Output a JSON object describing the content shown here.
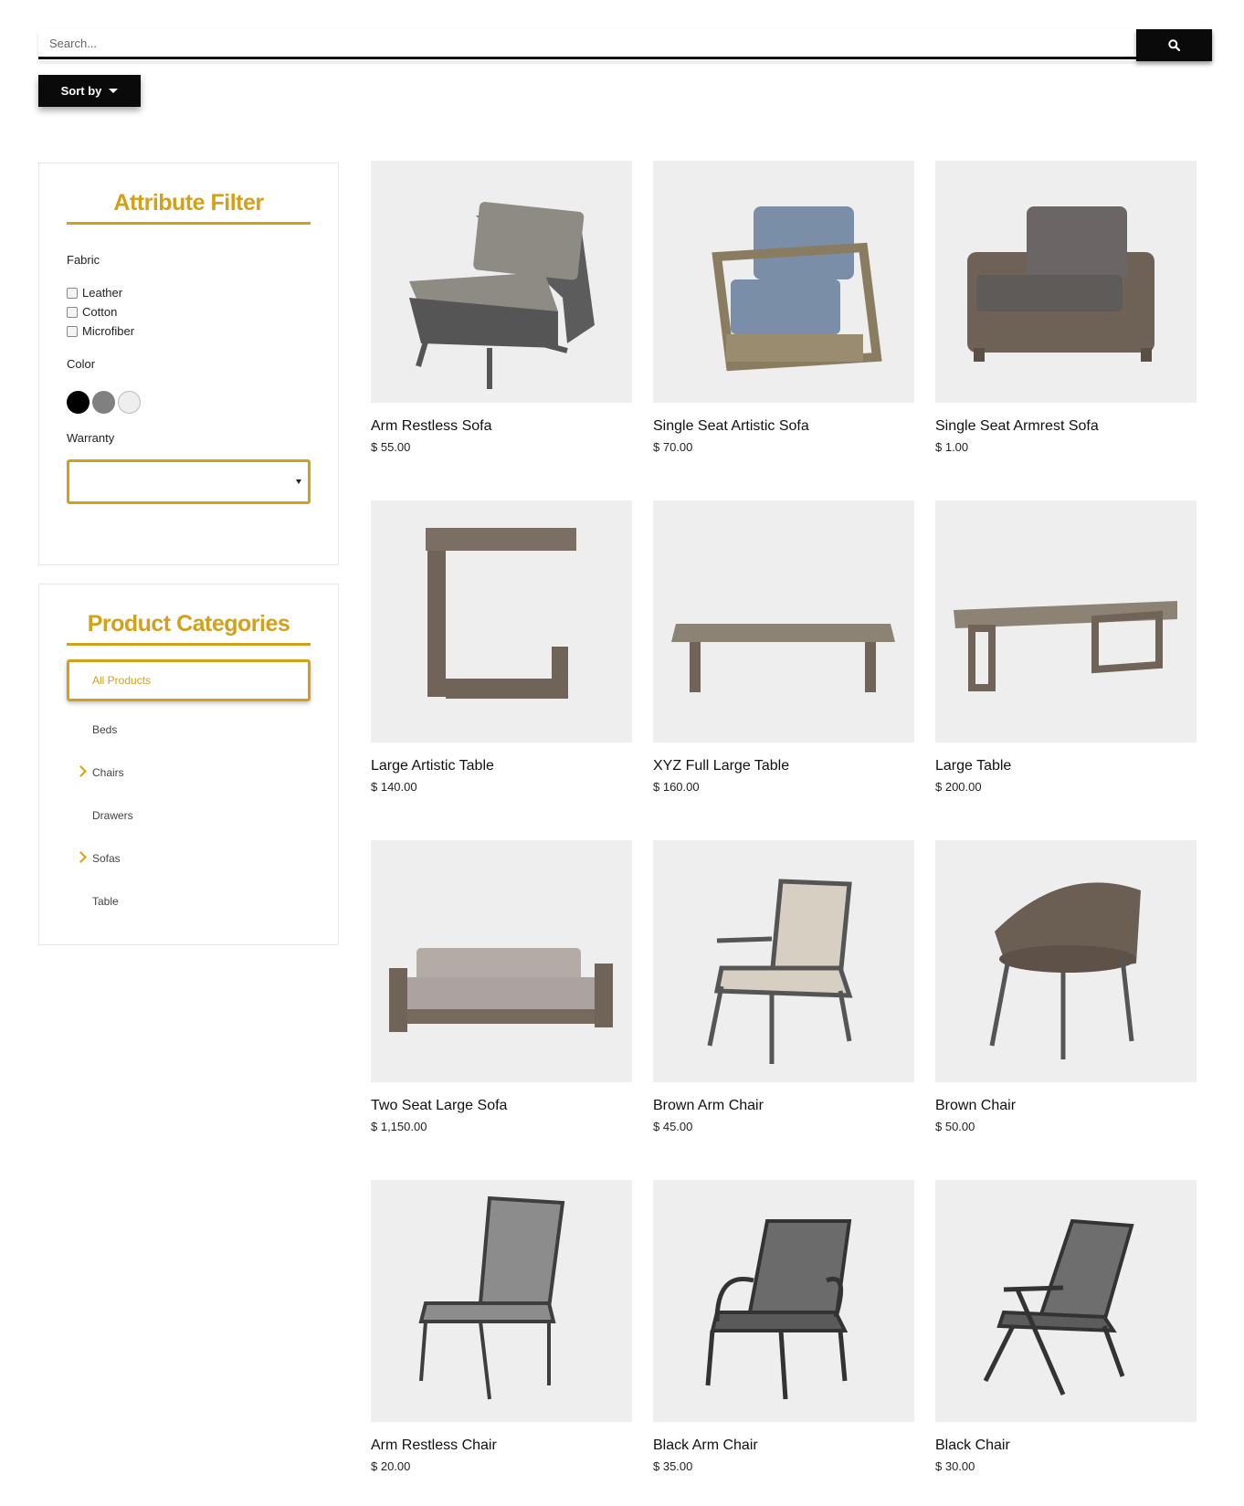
{
  "search": {
    "placeholder": "Search..."
  },
  "sort": {
    "label": "Sort by"
  },
  "attribute_filter": {
    "title": "Attribute Filter",
    "fabric_label": "Fabric",
    "fabrics": [
      "Leather",
      "Cotton",
      "Microfiber"
    ],
    "color_label": "Color",
    "colors": [
      "#000000",
      "#808080",
      "#eeeeee"
    ],
    "warranty_label": "Warranty"
  },
  "categories": {
    "title": "Product Categories",
    "active": "All Products",
    "items": [
      "Beds",
      "Chairs",
      "Drawers",
      "Sofas",
      "Table"
    ]
  },
  "products": [
    {
      "name": "Arm Restless Sofa",
      "price": "$ 55.00"
    },
    {
      "name": "Single Seat Artistic Sofa",
      "price": "$ 70.00"
    },
    {
      "name": "Single Seat Armrest Sofa",
      "price": "$ 1.00"
    },
    {
      "name": "Large Artistic Table",
      "price": "$ 140.00"
    },
    {
      "name": "XYZ Full Large Table",
      "price": "$ 160.00"
    },
    {
      "name": "Large Table",
      "price": "$ 200.00"
    },
    {
      "name": "Two Seat Large Sofa",
      "price": "$ 1,150.00"
    },
    {
      "name": "Brown Arm Chair",
      "price": "$ 45.00"
    },
    {
      "name": "Brown Chair",
      "price": "$ 50.00"
    },
    {
      "name": "Arm Restless Chair",
      "price": "$ 20.00"
    },
    {
      "name": "Black Arm Chair",
      "price": "$ 35.00"
    },
    {
      "name": "Black Chair",
      "price": "$ 30.00"
    }
  ]
}
